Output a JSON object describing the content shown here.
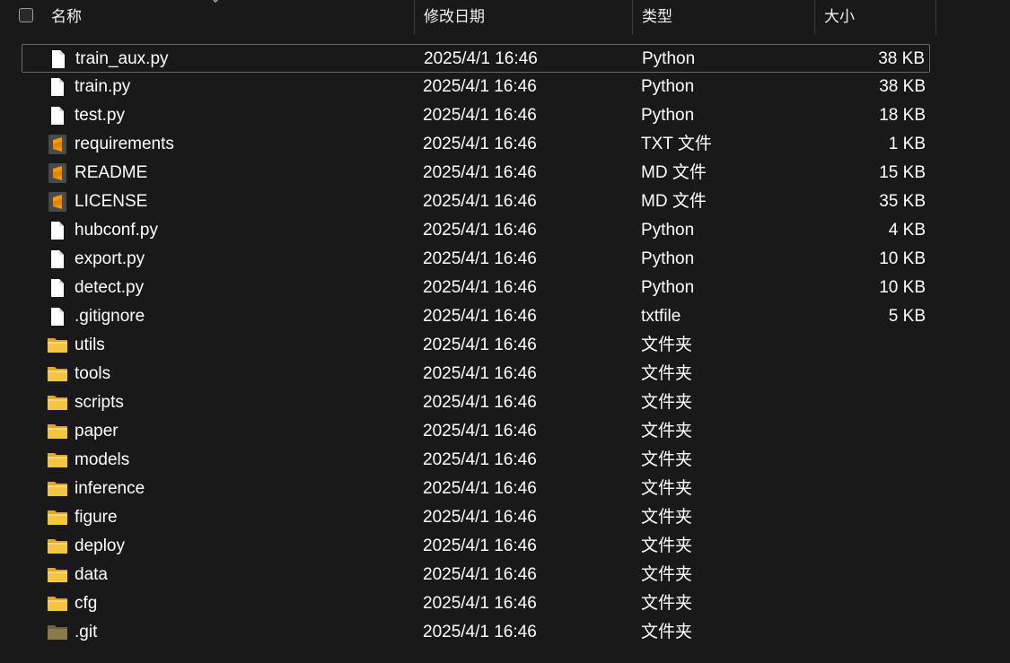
{
  "header": {
    "name_label": "名称",
    "date_label": "修改日期",
    "type_label": "类型",
    "size_label": "大小"
  },
  "colors": {
    "background": "#191919",
    "text": "#ffffff",
    "folder": "#f5c440",
    "folder_hidden": "#8a7a4a",
    "sublime": "#ff9800"
  },
  "files": [
    {
      "name": "train_aux.py",
      "date": "2025/4/1 16:46",
      "type": "Python",
      "size": "38 KB",
      "icon": "file-icon",
      "selected": true
    },
    {
      "name": "train.py",
      "date": "2025/4/1 16:46",
      "type": "Python",
      "size": "38 KB",
      "icon": "file-icon"
    },
    {
      "name": "test.py",
      "date": "2025/4/1 16:46",
      "type": "Python",
      "size": "18 KB",
      "icon": "file-icon"
    },
    {
      "name": "requirements",
      "date": "2025/4/1 16:46",
      "type": "TXT 文件",
      "size": "1 KB",
      "icon": "sublime-icon"
    },
    {
      "name": "README",
      "date": "2025/4/1 16:46",
      "type": "MD 文件",
      "size": "15 KB",
      "icon": "sublime-icon"
    },
    {
      "name": "LICENSE",
      "date": "2025/4/1 16:46",
      "type": "MD 文件",
      "size": "35 KB",
      "icon": "sublime-icon"
    },
    {
      "name": "hubconf.py",
      "date": "2025/4/1 16:46",
      "type": "Python",
      "size": "4 KB",
      "icon": "file-icon"
    },
    {
      "name": "export.py",
      "date": "2025/4/1 16:46",
      "type": "Python",
      "size": "10 KB",
      "icon": "file-icon"
    },
    {
      "name": "detect.py",
      "date": "2025/4/1 16:46",
      "type": "Python",
      "size": "10 KB",
      "icon": "file-icon"
    },
    {
      "name": ".gitignore",
      "date": "2025/4/1 16:46",
      "type": "txtfile",
      "size": "5 KB",
      "icon": "file-icon"
    },
    {
      "name": "utils",
      "date": "2025/4/1 16:46",
      "type": "文件夹",
      "size": "",
      "icon": "folder-icon"
    },
    {
      "name": "tools",
      "date": "2025/4/1 16:46",
      "type": "文件夹",
      "size": "",
      "icon": "folder-icon"
    },
    {
      "name": "scripts",
      "date": "2025/4/1 16:46",
      "type": "文件夹",
      "size": "",
      "icon": "folder-icon"
    },
    {
      "name": "paper",
      "date": "2025/4/1 16:46",
      "type": "文件夹",
      "size": "",
      "icon": "folder-icon"
    },
    {
      "name": "models",
      "date": "2025/4/1 16:46",
      "type": "文件夹",
      "size": "",
      "icon": "folder-icon"
    },
    {
      "name": "inference",
      "date": "2025/4/1 16:46",
      "type": "文件夹",
      "size": "",
      "icon": "folder-icon"
    },
    {
      "name": "figure",
      "date": "2025/4/1 16:46",
      "type": "文件夹",
      "size": "",
      "icon": "folder-icon"
    },
    {
      "name": "deploy",
      "date": "2025/4/1 16:46",
      "type": "文件夹",
      "size": "",
      "icon": "folder-icon"
    },
    {
      "name": "data",
      "date": "2025/4/1 16:46",
      "type": "文件夹",
      "size": "",
      "icon": "folder-icon"
    },
    {
      "name": "cfg",
      "date": "2025/4/1 16:46",
      "type": "文件夹",
      "size": "",
      "icon": "folder-icon"
    },
    {
      "name": ".git",
      "date": "2025/4/1 16:46",
      "type": "文件夹",
      "size": "",
      "icon": "folder-hidden-icon"
    }
  ]
}
